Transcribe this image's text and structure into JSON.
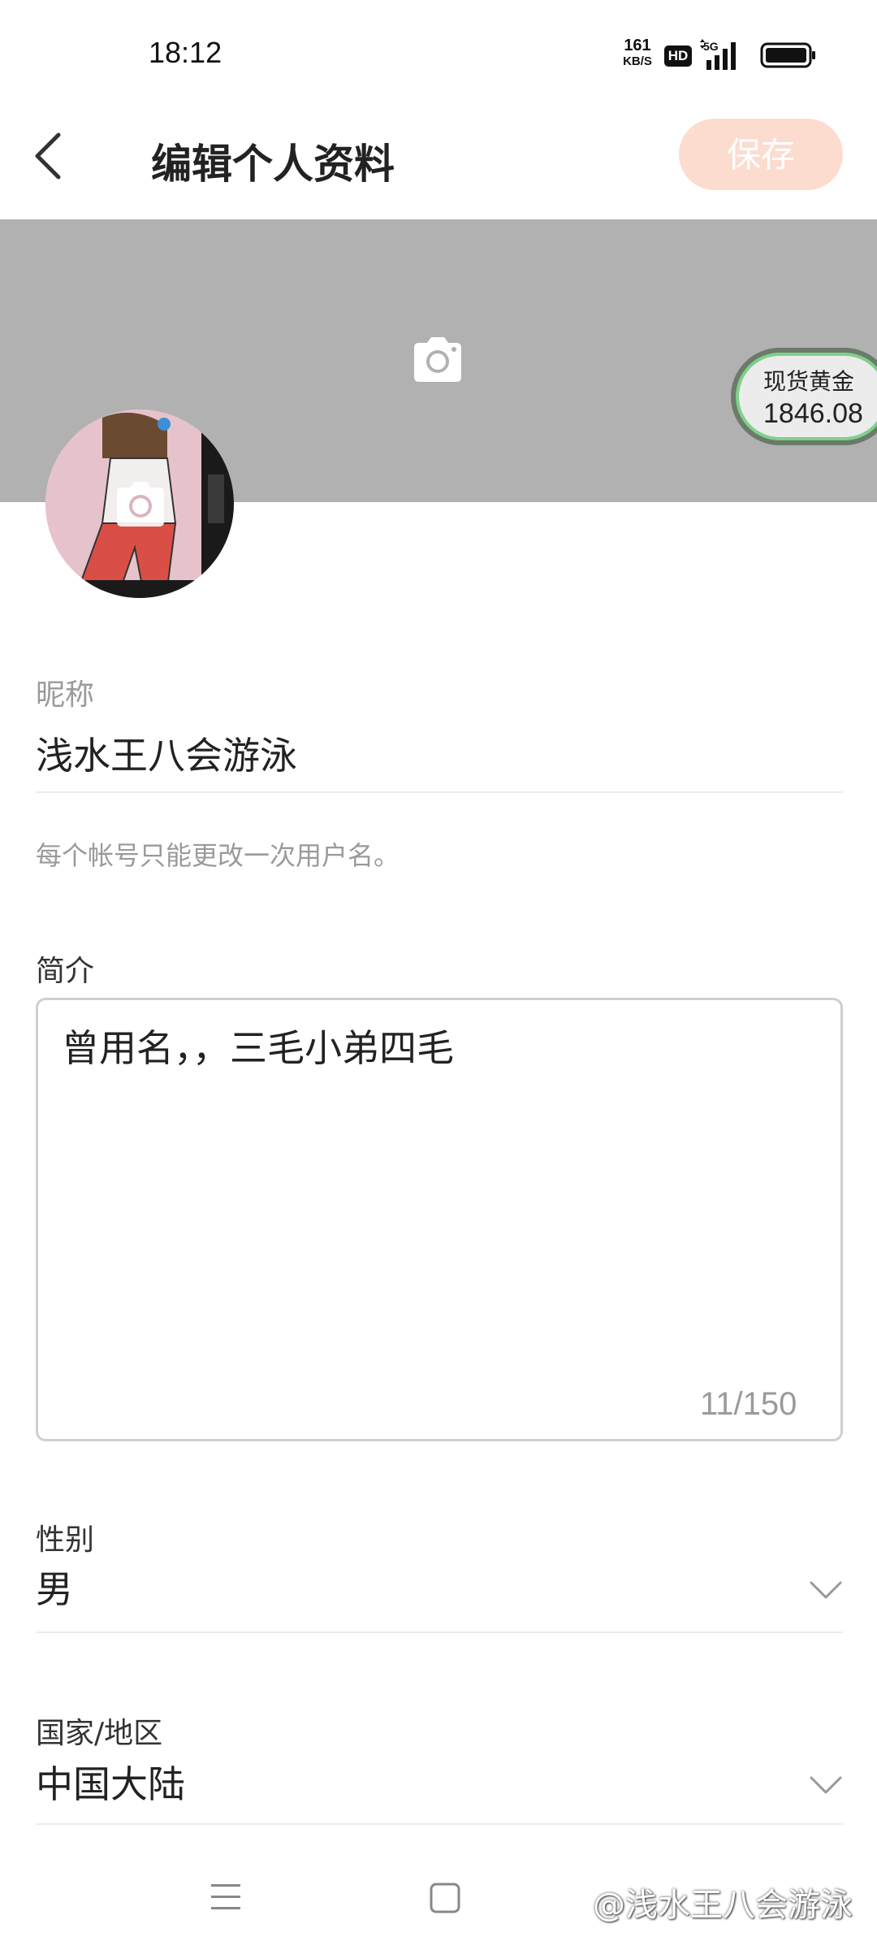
{
  "status_bar": {
    "time": "18:12",
    "net_speed_value": "161",
    "net_speed_unit": "KB/S",
    "hd_label": "HD",
    "network": "5G"
  },
  "header": {
    "title": "编辑个人资料",
    "save_label": "保存"
  },
  "gold_widget": {
    "label": "现货黄金",
    "value": "1846.08"
  },
  "form": {
    "nickname_label": "昵称",
    "nickname_value": "浅水王八会游泳",
    "nickname_hint": "每个帐号只能更改一次用户名。",
    "bio_label": "简介",
    "bio_value": "曾用名，，三毛小弟四毛",
    "bio_counter": "11/150",
    "gender_label": "性别",
    "gender_value": "男",
    "region_label": "国家/地区",
    "region_value": "中国大陆"
  },
  "watermark": "@浅水王八会游泳",
  "colors": {
    "save_button_bg": "#fcdccf",
    "cover_bg": "#b1b1b1",
    "gold_border": "#7fd08a"
  }
}
